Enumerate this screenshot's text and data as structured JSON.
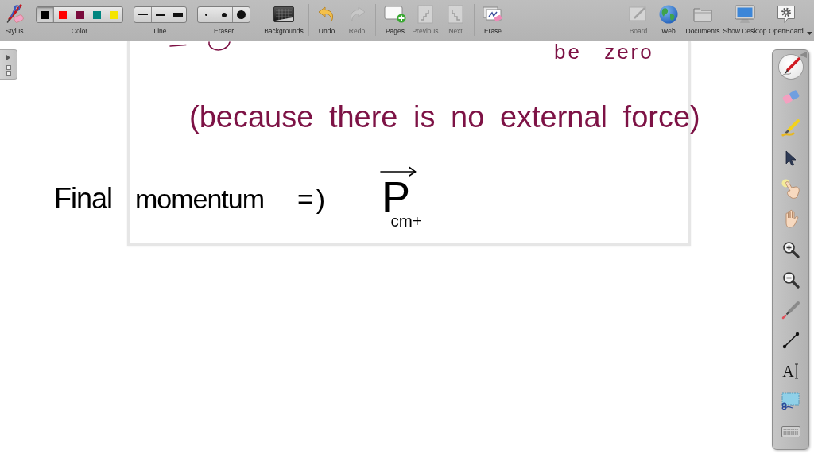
{
  "toolbar": {
    "items": [
      {
        "kind": "stylus",
        "label": "Stylus",
        "disabled": false
      },
      {
        "kind": "color",
        "label": "Color",
        "options": [
          {
            "color": "#000000",
            "selected": true
          },
          {
            "color": "#ff0000",
            "selected": false
          },
          {
            "color": "#7a0a3c",
            "selected": false
          },
          {
            "color": "#00857f",
            "selected": false
          },
          {
            "color": "#f5e400",
            "selected": false
          }
        ]
      },
      {
        "kind": "line",
        "label": "Line",
        "options": [
          {
            "selected": false
          },
          {
            "selected": false
          },
          {
            "selected": false
          }
        ]
      },
      {
        "kind": "eraser",
        "label": "Eraser",
        "options": [
          {
            "selected": false
          },
          {
            "selected": false
          },
          {
            "selected": false
          }
        ]
      },
      {
        "kind": "backgrounds",
        "label": "Backgrounds",
        "disabled": false
      },
      {
        "kind": "undo",
        "label": "Undo",
        "disabled": false
      },
      {
        "kind": "redo",
        "label": "Redo",
        "disabled": true
      },
      {
        "kind": "pages",
        "label": "Pages",
        "disabled": false
      },
      {
        "kind": "previous",
        "label": "Previous",
        "disabled": true
      },
      {
        "kind": "next",
        "label": "Next",
        "disabled": true
      },
      {
        "kind": "erase",
        "label": "Erase",
        "disabled": false
      }
    ],
    "right_items": [
      {
        "kind": "board",
        "label": "Board",
        "disabled": true
      },
      {
        "kind": "web",
        "label": "Web",
        "disabled": false
      },
      {
        "kind": "documents",
        "label": "Documents",
        "disabled": false
      },
      {
        "kind": "show_desktop",
        "label": "Show Desktop",
        "disabled": false
      },
      {
        "kind": "openboard",
        "label": "OpenBoard",
        "disabled": false
      }
    ]
  },
  "board": {
    "ink": [
      {
        "kind": "text",
        "text": "be zero",
        "color": "#7d1245"
      },
      {
        "kind": "text",
        "text": "(because there is no external force)",
        "color": "#7d1245"
      },
      {
        "kind": "text",
        "text": "Final",
        "color": "#000000"
      },
      {
        "kind": "text",
        "text": "momentum",
        "color": "#000000"
      },
      {
        "kind": "text",
        "text": "=)",
        "color": "#000000"
      },
      {
        "kind": "vector",
        "text": "P$_{cm+}$",
        "color": "#000000"
      }
    ]
  },
  "tool_palette": {
    "tools": [
      {
        "kind": "pen",
        "selected": true
      },
      {
        "kind": "eraser",
        "selected": false
      },
      {
        "kind": "marker",
        "selected": false
      },
      {
        "kind": "selector",
        "selected": false
      },
      {
        "kind": "play",
        "selected": false
      },
      {
        "kind": "hand",
        "selected": false
      },
      {
        "kind": "zoom_in",
        "selected": false
      },
      {
        "kind": "zoom_out",
        "selected": false
      },
      {
        "kind": "laser",
        "selected": false
      },
      {
        "kind": "line",
        "selected": false
      },
      {
        "kind": "text",
        "glyph": "A",
        "selected": false
      },
      {
        "kind": "capture",
        "selected": false
      },
      {
        "kind": "keyboard",
        "selected": false
      }
    ]
  }
}
